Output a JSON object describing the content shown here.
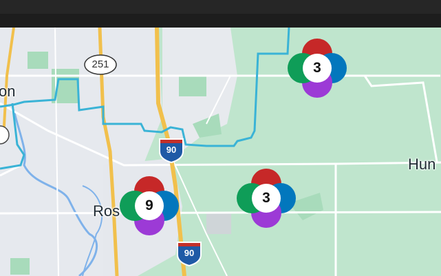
{
  "map": {
    "places": {
      "left_partial": "on",
      "rosc_partial": "Ros",
      "hun_partial": "Hun"
    },
    "route_shields": {
      "state_route": "251",
      "interstate_upper": "90",
      "interstate_lower": "90"
    },
    "clusters": [
      {
        "count": "3",
        "colors": [
          "#c62828",
          "#0277bd",
          "#9c3ad6",
          "#0f9d58"
        ]
      },
      {
        "count": "9",
        "colors": [
          "#c62828",
          "#0277bd",
          "#9c3ad6",
          "#0f9d58"
        ]
      },
      {
        "count": "3",
        "colors": [
          "#c62828",
          "#0277bd",
          "#9c3ad6",
          "#0f9d58"
        ]
      }
    ],
    "colors": {
      "land": "#bfe5cd",
      "urban": "#e6e9ee",
      "park": "#a8dbbb",
      "water": "#7fb2ea",
      "boundary": "#3ab3d6",
      "highway": "#f1c04c",
      "road": "#ffffff"
    }
  }
}
